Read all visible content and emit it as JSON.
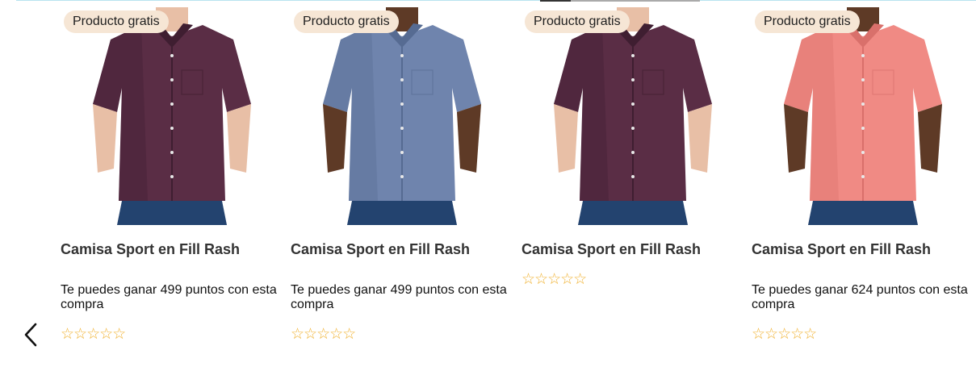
{
  "products": [
    {
      "badge": "Producto gratis",
      "title": "Camisa Sport en Fill Rash",
      "points": "Te puedes ganar 499 puntos con esta compra",
      "rating": "☆☆☆☆☆",
      "shirt_color": "#5a2d45",
      "shirt_shade": "#3f1e31",
      "skin": "#e8bfa6"
    },
    {
      "badge": "Producto gratis",
      "title": "Camisa Sport en Fill Rash",
      "points": "Te puedes ganar 499 puntos con esta compra",
      "rating": "☆☆☆☆☆",
      "shirt_color": "#6f84ad",
      "shirt_shade": "#566b92",
      "skin": "#5e3a26"
    },
    {
      "badge": "Producto gratis",
      "title": "Camisa Sport en Fill Rash",
      "points": "",
      "rating": "☆☆☆☆☆",
      "shirt_color": "#5a2d45",
      "shirt_shade": "#3f1e31",
      "skin": "#e8bfa6"
    },
    {
      "badge": "Producto gratis",
      "title": "Camisa Sport en Fill Rash",
      "points": "Te puedes ganar 624 puntos con esta compra",
      "rating": "☆☆☆☆☆",
      "shirt_color": "#f08a84",
      "shirt_shade": "#d9706b",
      "skin": "#5e3a26"
    }
  ],
  "navigation": {
    "prev_icon": "chevron-left-icon"
  },
  "colors": {
    "badge_bg": "#f6e6d5",
    "star": "#f0b232",
    "jeans": "#23436f"
  }
}
